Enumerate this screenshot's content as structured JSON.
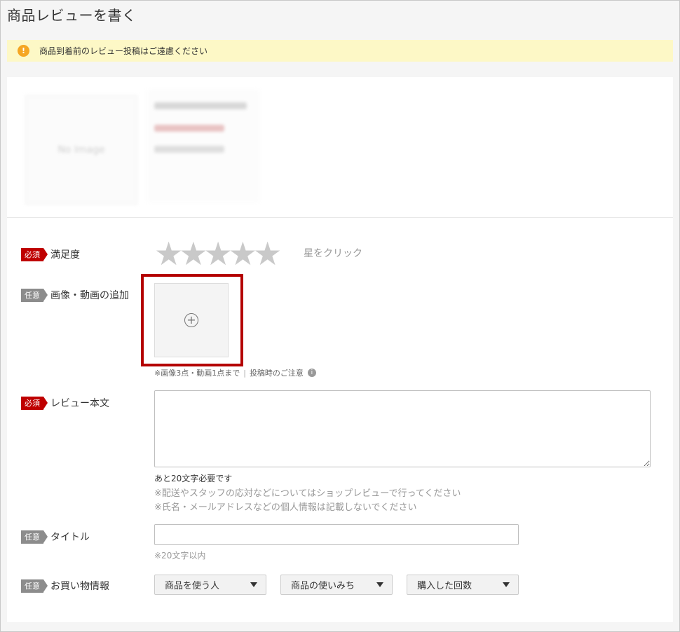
{
  "page": {
    "title": "商品レビューを書く"
  },
  "notice": {
    "icon": "info-icon",
    "text": "商品到着前のレビュー投稿はご遠慮ください"
  },
  "colors": {
    "required_badge": "#bf0000",
    "optional_badge": "#8c8c8c",
    "highlight": "#b40000",
    "notice_bg": "#fdf8c6",
    "star_empty": "#c9c9c9"
  },
  "product": {
    "thumbnail_text": "No Image"
  },
  "satisfaction": {
    "badge": "必須",
    "label": "満足度",
    "hint": "星をクリック",
    "rating": 0,
    "max": 5
  },
  "media": {
    "badge": "任意",
    "label": "画像・動画の追加",
    "note": "※画像3点・動画1点まで",
    "note_link": "投稿時のご注意"
  },
  "review_body": {
    "badge": "必須",
    "label": "レビュー本文",
    "value": "",
    "remaining": "あと20文字必要です",
    "hint1": "※配送やスタッフの応対などについてはショップレビューで行ってください",
    "hint2": "※氏名・メールアドレスなどの個人情報は記載しないでください"
  },
  "title_field": {
    "badge": "任意",
    "label": "タイトル",
    "value": "",
    "limit": "※20文字以内"
  },
  "purchase_info": {
    "badge": "任意",
    "label": "お買い物情報",
    "selects": [
      "商品を使う人",
      "商品の使いみち",
      "購入した回数"
    ]
  }
}
